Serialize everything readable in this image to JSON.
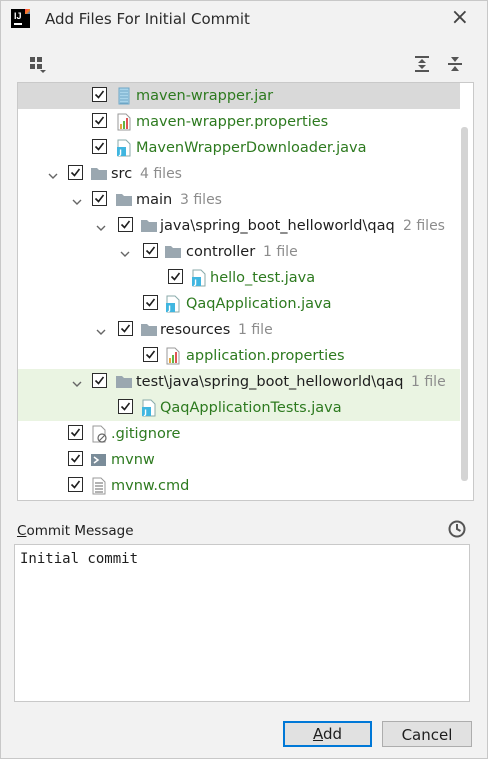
{
  "dialog": {
    "title": "Add Files For Initial Commit",
    "close_glyph": "×"
  },
  "toolbar": {
    "group_by_icon": "group-by-icon",
    "expand_all_icon": "expand-all-icon",
    "collapse_all_icon": "collapse-all-icon"
  },
  "tree": {
    "rows": [
      {
        "label": "maven-wrapper.jar",
        "icon": "jar-icon",
        "checked": true,
        "color": "green",
        "selected": true
      },
      {
        "label": "maven-wrapper.properties",
        "icon": "properties-icon",
        "checked": true,
        "color": "green"
      },
      {
        "label": "MavenWrapperDownloader.java",
        "icon": "java-file-icon",
        "checked": true,
        "color": "green"
      },
      {
        "label": "src",
        "count": "4 files",
        "icon": "folder-icon",
        "checked": true,
        "expanded": true,
        "color": "dark"
      },
      {
        "label": "main",
        "count": "3 files",
        "icon": "folder-icon",
        "checked": true,
        "expanded": true,
        "color": "dark"
      },
      {
        "label": "java\\spring_boot_helloworld\\qaq",
        "count": "2 files",
        "icon": "folder-icon",
        "checked": true,
        "expanded": true,
        "color": "dark"
      },
      {
        "label": "controller",
        "count": "1 file",
        "icon": "folder-icon",
        "checked": true,
        "expanded": true,
        "color": "dark"
      },
      {
        "label": "hello_test.java",
        "icon": "java-file-icon",
        "checked": true,
        "color": "green"
      },
      {
        "label": "QaqApplication.java",
        "icon": "java-file-icon",
        "checked": true,
        "color": "green"
      },
      {
        "label": "resources",
        "count": "1 file",
        "icon": "folder-icon",
        "checked": true,
        "expanded": true,
        "color": "dark"
      },
      {
        "label": "application.properties",
        "icon": "properties-icon",
        "checked": true,
        "color": "green"
      },
      {
        "label": "test\\java\\spring_boot_helloworld\\qaq",
        "count": "1 file",
        "icon": "folder-icon",
        "checked": true,
        "expanded": true,
        "color": "dark",
        "highlight": true
      },
      {
        "label": "QaqApplicationTests.java",
        "icon": "java-file-icon",
        "checked": true,
        "color": "green",
        "highlight": true
      },
      {
        "label": ".gitignore",
        "icon": "gitignore-icon",
        "checked": true,
        "color": "green"
      },
      {
        "label": "mvnw",
        "icon": "shell-script-icon",
        "checked": true,
        "color": "green"
      },
      {
        "label": "mvnw.cmd",
        "icon": "text-file-icon",
        "checked": true,
        "color": "green"
      }
    ]
  },
  "commit": {
    "label": "Commit Message",
    "message": "Initial commit",
    "history_icon": "history-icon"
  },
  "buttons": {
    "add": "Add",
    "cancel": "Cancel"
  },
  "colors": {
    "added_file": "#2d7a1f",
    "selection": "#d9d9d9",
    "test_highlight": "#eaf4e2",
    "primary_border": "#0078d7"
  }
}
